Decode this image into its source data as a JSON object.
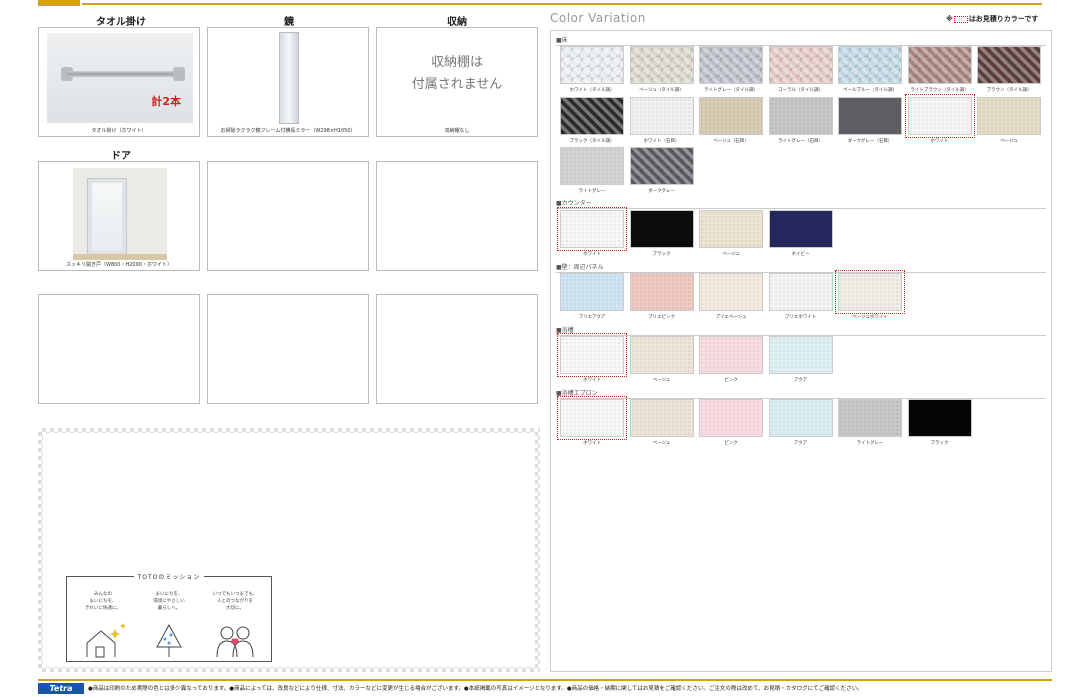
{
  "left": {
    "headers": {
      "towel": "タオル掛け",
      "mirror": "鏡",
      "storage": "収納",
      "door": "ドア"
    },
    "towel_caption": "タオル掛け（ホワイト）",
    "towel_note": "計2本",
    "mirror_caption": "お掃除ラクラク鏡フレーム付横長ミラー（W298×H1050）",
    "storage_text_1": "収納棚は",
    "storage_text_2": "付属されません",
    "storage_caption": "収納棚なし",
    "door_caption": "スッキリ開き戸（W800・H2000・ホワイト）"
  },
  "mission": {
    "title": "TOTOのミッション",
    "col1": [
      "みんなの",
      "まいにちを、",
      "きれいに快適に。"
    ],
    "col2": [
      "まいにちを、",
      "環境にやさしい",
      "暮らしへ。"
    ],
    "col3": [
      "いつでもいつまでも、",
      "人とのつながりを",
      "大切に。"
    ]
  },
  "color_variation": {
    "title": "Color Variation",
    "note_prefix": "※",
    "note_suffix": "はお見積りカラーです",
    "sections": {
      "floor": "■床",
      "counter": "■カウンター",
      "wall": "■壁：周辺パネル",
      "tub": "■浴槽",
      "apron": "■浴槽エプロン"
    },
    "floor": [
      {
        "label": "ホワイト（タイル調）",
        "color": "#e9ecef",
        "tile": true
      },
      {
        "label": "ベージュ（タイル調）",
        "color": "#d9d5cc",
        "tile": true
      },
      {
        "label": "ライトグレー（タイル調）",
        "color": "#b9bfc6",
        "tile": true
      },
      {
        "label": "コーラル（タイル調）",
        "color": "#e3c7c2",
        "tile": true
      },
      {
        "label": "ペールブルー（タイル調）",
        "color": "#bfd6e4",
        "tile": true
      },
      {
        "label": "ライトブラウン（タイル調）",
        "color": "#a7857d",
        "tile": true
      },
      {
        "label": "ブラウン（タイル調）",
        "color": "#5b3f3c",
        "tile": true
      },
      {
        "label": "ブラック（タイル調）",
        "color": "#2b2b2e",
        "tile": true
      },
      {
        "label": "ホワイト（石目）",
        "color": "#eef0f1",
        "tile": false
      },
      {
        "label": "ベージュ（石目）",
        "color": "#d9ccb5",
        "tile": false
      },
      {
        "label": "ライトグレー（石目）",
        "color": "#c6c8c6",
        "tile": false
      },
      {
        "label": "ダークグレー（石目）",
        "color": "#5e5f63",
        "tile": false
      },
      {
        "label": "ホワイト",
        "color": "#f6f6f6",
        "tile": false,
        "selected": true
      },
      {
        "label": "ベージュ",
        "color": "#e6ddc9",
        "tile": false
      },
      {
        "label": "ライトグレー",
        "color": "#d2d3d3",
        "tile": false
      },
      {
        "label": "ダークグレー",
        "color": "#5b5a60",
        "tile": true
      }
    ],
    "counter": [
      {
        "label": "ホワイト",
        "color": "#f7f7f7",
        "selected": true
      },
      {
        "label": "ブラック",
        "color": "#0d0d0d"
      },
      {
        "label": "ベージュ",
        "color": "#ece3d0"
      },
      {
        "label": "ネイビー",
        "color": "#24285c"
      }
    ],
    "wall": [
      {
        "label": "プリエアクア",
        "color": "#cfe6f2"
      },
      {
        "label": "プリエピンク",
        "color": "#eec9c0"
      },
      {
        "label": "プリエベージュ",
        "color": "#f4ebdf"
      },
      {
        "label": "プリエホワイト",
        "color": "#f4f4f6"
      },
      {
        "label": "ベージュホワイト",
        "color": "#f0ece6",
        "selected": true
      }
    ],
    "tub": [
      {
        "label": "ホワイト",
        "color": "#f8f8f8",
        "selected": true
      },
      {
        "label": "ベージュ",
        "color": "#ede5d8"
      },
      {
        "label": "ピンク",
        "color": "#f7dce0"
      },
      {
        "label": "アクア",
        "color": "#dff0f3"
      }
    ],
    "apron": [
      {
        "label": "ホワイト",
        "color": "#f8f8f8",
        "selected": true
      },
      {
        "label": "ベージュ",
        "color": "#ece4d7"
      },
      {
        "label": "ピンク",
        "color": "#f7dbe0"
      },
      {
        "label": "アクア",
        "color": "#dcedf1"
      },
      {
        "label": "ライトグレー",
        "color": "#c9c7c6"
      },
      {
        "label": "ブラック",
        "color": "#050505"
      }
    ]
  },
  "footer": {
    "logo": "Tetra",
    "text": "●商品は印刷のため実際の色とは多少異なっております。●商品によっては、改良などにより仕様、寸法、カラーなどに変更が生じる場合がございます。●本紙掲載の写真はイメージとなります。●商品の価格・納期に関してはお見積をご確認ください。ご注文の際は改めて、お見積・カタログにてご確認ください。"
  }
}
